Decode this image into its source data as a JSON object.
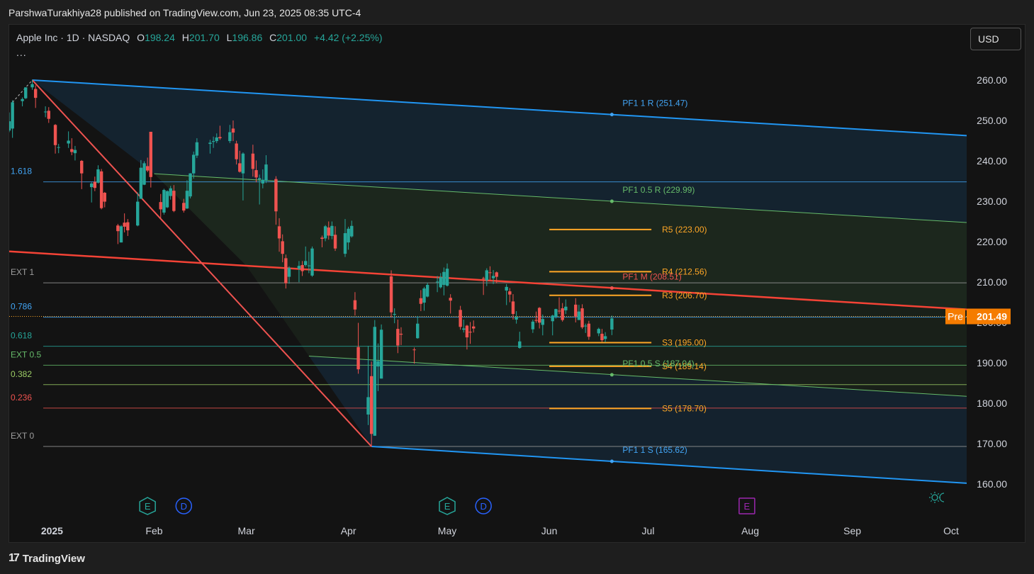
{
  "publisher": "ParshwaTurakhiya28 published on TradingView.com, Jun 23, 2025 08:35 UTC-4",
  "legend": {
    "symbol": "Apple Inc · 1D · NASDAQ",
    "o_label": "O",
    "o": "198.24",
    "h_label": "H",
    "h": "201.70",
    "l_label": "L",
    "l": "196.86",
    "c_label": "C",
    "c": "201.00",
    "change": "+4.42 (+2.25%)",
    "more": "..."
  },
  "currency": "USD",
  "brand": "TradingView",
  "colors": {
    "up": "#26a69a",
    "down": "#ef5350",
    "channel": "#2196f3",
    "mid": "#f44336",
    "pivot": "#ffa726",
    "inner": "#66bb6a"
  },
  "icons": [
    "theme-toggle-icon"
  ],
  "chart_data": {
    "type": "candlestick",
    "ylim": [
      155,
      265
    ],
    "yticks": [
      "260.00",
      "250.00",
      "240.00",
      "230.00",
      "220.00",
      "210.00",
      "200.00",
      "190.00",
      "180.00",
      "170.00",
      "160.00"
    ],
    "x_start": "2024-12-19",
    "x_end": "2025-10-06",
    "xticks": [
      {
        "date": "2025-01-01",
        "label": "2025"
      },
      {
        "date": "2025-02-01",
        "label": "Feb"
      },
      {
        "date": "2025-03-01",
        "label": "Mar"
      },
      {
        "date": "2025-04-01",
        "label": "Apr"
      },
      {
        "date": "2025-05-01",
        "label": "May"
      },
      {
        "date": "2025-06-01",
        "label": "Jun"
      },
      {
        "date": "2025-07-01",
        "label": "Jul"
      },
      {
        "date": "2025-08-01",
        "label": "Aug"
      },
      {
        "date": "2025-09-01",
        "label": "Sep"
      },
      {
        "date": "2025-10-01",
        "label": "Oct"
      }
    ],
    "price_label": {
      "tag": "Pre",
      "value": "201.49",
      "y": 201.49
    },
    "fib_levels": [
      {
        "label": "1.618",
        "y": 234.8,
        "color": "#42a5f5"
      },
      {
        "label": "EXT 1",
        "y": 209.8,
        "color": "#9e9e9e"
      },
      {
        "label": "0.786",
        "y": 201.3,
        "color": "#42a5f5"
      },
      {
        "label": "0.618",
        "y": 194.1,
        "color": "#26a69a"
      },
      {
        "label": "EXT 0.5",
        "y": 189.4,
        "color": "#66bb6a"
      },
      {
        "label": "0.382",
        "y": 184.6,
        "color": "#9ccc65"
      },
      {
        "label": "0.236",
        "y": 178.8,
        "color": "#ef5350"
      },
      {
        "label": "EXT 0",
        "y": 169.3,
        "color": "#9e9e9e"
      }
    ],
    "pivots": [
      {
        "label": "R5 (223.00)",
        "y": 223.0
      },
      {
        "label": "R4 (212.56)",
        "y": 212.56
      },
      {
        "label": "R3 (206.70)",
        "y": 206.7
      },
      {
        "label": "S3 (195.00)",
        "y": 195.0
      },
      {
        "label": "S4 (189.14)",
        "y": 189.14
      },
      {
        "label": "S5 (178.70)",
        "y": 178.7
      }
    ],
    "pivot_span": [
      "2025-06-01",
      "2025-07-02"
    ],
    "channel_labels": [
      {
        "label": "PF1 1 R (251.47)",
        "y": 251.47,
        "color": "#42a5f5"
      },
      {
        "label": "PF1 0.5 R (229.99)",
        "y": 229.99,
        "color": "#66bb6a"
      },
      {
        "label": "PF1 M (208.51)",
        "y": 208.51,
        "color": "#ef5350"
      },
      {
        "label": "PF1 0.5 S (187.04)",
        "y": 187.04,
        "color": "#66bb6a"
      },
      {
        "label": "PF1 1 S (165.62)",
        "y": 165.62,
        "color": "#42a5f5"
      }
    ],
    "channel_label_date": "2025-06-20",
    "events": [
      {
        "label": "E",
        "date": "2025-01-30",
        "color": "#26a69a"
      },
      {
        "label": "D",
        "date": "2025-02-10",
        "color": "#2962ff"
      },
      {
        "label": "E",
        "date": "2025-05-01",
        "color": "#26a69a"
      },
      {
        "label": "D",
        "date": "2025-05-12",
        "color": "#2962ff"
      },
      {
        "label": "E",
        "date": "2025-07-31",
        "color": "#9c27b0"
      }
    ],
    "series": [
      {
        "d": "2024-12-19",
        "o": 247.5,
        "h": 252.0,
        "l": 247.1,
        "c": 249.8
      },
      {
        "d": "2024-12-20",
        "o": 248.0,
        "h": 255.0,
        "l": 245.7,
        "c": 254.5
      },
      {
        "d": "2024-12-23",
        "o": 254.8,
        "h": 255.7,
        "l": 253.5,
        "c": 255.3
      },
      {
        "d": "2024-12-24",
        "o": 255.5,
        "h": 258.2,
        "l": 255.3,
        "c": 258.2
      },
      {
        "d": "2024-12-26",
        "o": 258.2,
        "h": 260.1,
        "l": 257.6,
        "c": 259.0
      },
      {
        "d": "2024-12-27",
        "o": 257.8,
        "h": 258.7,
        "l": 253.1,
        "c": 255.6
      },
      {
        "d": "2024-12-30",
        "o": 252.2,
        "h": 253.5,
        "l": 250.8,
        "c": 252.2
      },
      {
        "d": "2024-12-31",
        "o": 252.4,
        "h": 253.3,
        "l": 249.4,
        "c": 250.4
      },
      {
        "d": "2025-01-02",
        "o": 248.9,
        "h": 249.1,
        "l": 241.8,
        "c": 243.9
      },
      {
        "d": "2025-01-03",
        "o": 243.4,
        "h": 244.2,
        "l": 241.9,
        "c": 243.4
      },
      {
        "d": "2025-01-06",
        "o": 244.3,
        "h": 247.3,
        "l": 243.2,
        "c": 245.0
      },
      {
        "d": "2025-01-07",
        "o": 242.9,
        "h": 245.6,
        "l": 241.4,
        "c": 242.2
      },
      {
        "d": "2025-01-08",
        "o": 241.9,
        "h": 243.7,
        "l": 240.1,
        "c": 242.7
      },
      {
        "d": "2025-01-10",
        "o": 240.0,
        "h": 240.2,
        "l": 233.0,
        "c": 236.9
      },
      {
        "d": "2025-01-13",
        "o": 233.5,
        "h": 234.7,
        "l": 229.7,
        "c": 234.4
      },
      {
        "d": "2025-01-14",
        "o": 234.8,
        "h": 236.1,
        "l": 232.5,
        "c": 233.3
      },
      {
        "d": "2025-01-15",
        "o": 234.6,
        "h": 238.9,
        "l": 234.4,
        "c": 237.9
      },
      {
        "d": "2025-01-16",
        "o": 237.4,
        "h": 238.0,
        "l": 228.0,
        "c": 228.3
      },
      {
        "d": "2025-01-17",
        "o": 232.1,
        "h": 232.3,
        "l": 228.5,
        "c": 229.9
      },
      {
        "d": "2025-01-21",
        "o": 224.0,
        "h": 224.4,
        "l": 219.4,
        "c": 222.6
      },
      {
        "d": "2025-01-22",
        "o": 219.8,
        "h": 224.1,
        "l": 219.8,
        "c": 223.8
      },
      {
        "d": "2025-01-23",
        "o": 224.7,
        "h": 227.0,
        "l": 222.3,
        "c": 223.7
      },
      {
        "d": "2025-01-24",
        "o": 224.8,
        "h": 225.6,
        "l": 221.4,
        "c": 222.8
      },
      {
        "d": "2025-01-27",
        "o": 224.0,
        "h": 232.2,
        "l": 223.8,
        "c": 229.9
      },
      {
        "d": "2025-01-28",
        "o": 230.6,
        "h": 240.2,
        "l": 230.8,
        "c": 238.3
      },
      {
        "d": "2025-01-29",
        "o": 234.1,
        "h": 239.9,
        "l": 234.0,
        "c": 239.4
      },
      {
        "d": "2025-01-30",
        "o": 238.7,
        "h": 240.8,
        "l": 237.2,
        "c": 237.6
      },
      {
        "d": "2025-01-31",
        "o": 247.2,
        "h": 247.2,
        "l": 233.4,
        "c": 236.0
      },
      {
        "d": "2025-02-03",
        "o": 229.8,
        "h": 231.8,
        "l": 225.7,
        "c": 228.0
      },
      {
        "d": "2025-02-04",
        "o": 227.2,
        "h": 233.1,
        "l": 226.7,
        "c": 232.8
      },
      {
        "d": "2025-02-05",
        "o": 228.5,
        "h": 232.7,
        "l": 228.3,
        "c": 232.5
      },
      {
        "d": "2025-02-06",
        "o": 231.3,
        "h": 233.8,
        "l": 230.4,
        "c": 233.2
      },
      {
        "d": "2025-02-07",
        "o": 232.6,
        "h": 234.0,
        "l": 227.3,
        "c": 227.6
      },
      {
        "d": "2025-02-10",
        "o": 229.6,
        "h": 230.6,
        "l": 227.2,
        "c": 227.7
      },
      {
        "d": "2025-02-11",
        "o": 228.2,
        "h": 235.2,
        "l": 228.1,
        "c": 232.6
      },
      {
        "d": "2025-02-12",
        "o": 231.2,
        "h": 236.96,
        "l": 230.7,
        "c": 236.9
      },
      {
        "d": "2025-02-13",
        "o": 236.9,
        "h": 242.3,
        "l": 235.6,
        "c": 241.5
      },
      {
        "d": "2025-02-14",
        "o": 241.3,
        "h": 245.6,
        "l": 240.7,
        "c": 244.6
      },
      {
        "d": "2025-02-18",
        "o": 244.2,
        "h": 245.2,
        "l": 241.8,
        "c": 244.5
      },
      {
        "d": "2025-02-19",
        "o": 244.7,
        "h": 246.0,
        "l": 243.2,
        "c": 244.9
      },
      {
        "d": "2025-02-20",
        "o": 244.9,
        "h": 246.8,
        "l": 244.4,
        "c": 245.8
      },
      {
        "d": "2025-02-21",
        "o": 245.9,
        "h": 248.7,
        "l": 245.2,
        "c": 245.6
      },
      {
        "d": "2025-02-24",
        "o": 244.9,
        "h": 248.9,
        "l": 244.4,
        "c": 247.1
      },
      {
        "d": "2025-02-25",
        "o": 248.0,
        "h": 250.0,
        "l": 244.9,
        "c": 247.0
      },
      {
        "d": "2025-02-26",
        "o": 244.3,
        "h": 244.98,
        "l": 239.1,
        "c": 240.4
      },
      {
        "d": "2025-02-27",
        "o": 239.4,
        "h": 242.5,
        "l": 237.1,
        "c": 237.3
      },
      {
        "d": "2025-02-28",
        "o": 236.9,
        "h": 242.1,
        "l": 230.2,
        "c": 241.8
      },
      {
        "d": "2025-03-03",
        "o": 241.8,
        "h": 244.0,
        "l": 236.1,
        "c": 238.0
      },
      {
        "d": "2025-03-04",
        "o": 237.7,
        "h": 240.1,
        "l": 234.7,
        "c": 235.9
      },
      {
        "d": "2025-03-05",
        "o": 235.4,
        "h": 236.6,
        "l": 229.2,
        "c": 235.7
      },
      {
        "d": "2025-03-06",
        "o": 234.4,
        "h": 237.9,
        "l": 233.2,
        "c": 235.3
      },
      {
        "d": "2025-03-07",
        "o": 235.1,
        "h": 241.4,
        "l": 234.5,
        "c": 239.1
      },
      {
        "d": "2025-03-10",
        "o": 235.5,
        "h": 236.2,
        "l": 224.2,
        "c": 227.5
      },
      {
        "d": "2025-03-11",
        "o": 223.8,
        "h": 225.8,
        "l": 217.5,
        "c": 220.8
      },
      {
        "d": "2025-03-12",
        "o": 220.1,
        "h": 221.8,
        "l": 214.9,
        "c": 216.98
      },
      {
        "d": "2025-03-13",
        "o": 215.9,
        "h": 216.8,
        "l": 208.4,
        "c": 209.7
      },
      {
        "d": "2025-03-14",
        "o": 211.3,
        "h": 213.9,
        "l": 209.6,
        "c": 213.5
      },
      {
        "d": "2025-03-17",
        "o": 213.3,
        "h": 215.2,
        "l": 209.97,
        "c": 214.0
      },
      {
        "d": "2025-03-18",
        "o": 214.2,
        "h": 215.2,
        "l": 211.5,
        "c": 212.7
      },
      {
        "d": "2025-03-19",
        "o": 214.2,
        "h": 218.8,
        "l": 213.8,
        "c": 215.2
      },
      {
        "d": "2025-03-20",
        "o": 213.99,
        "h": 217.5,
        "l": 212.2,
        "c": 214.1
      },
      {
        "d": "2025-03-21",
        "o": 211.6,
        "h": 218.8,
        "l": 211.3,
        "c": 218.3
      },
      {
        "d": "2025-03-24",
        "o": 221.0,
        "h": 221.5,
        "l": 218.6,
        "c": 220.7
      },
      {
        "d": "2025-03-25",
        "o": 220.8,
        "h": 224.1,
        "l": 220.1,
        "c": 223.8
      },
      {
        "d": "2025-03-26",
        "o": 223.5,
        "h": 225.0,
        "l": 220.5,
        "c": 221.5
      },
      {
        "d": "2025-03-27",
        "o": 221.4,
        "h": 224.99,
        "l": 220.6,
        "c": 223.9
      },
      {
        "d": "2025-03-28",
        "o": 221.7,
        "h": 223.8,
        "l": 217.7,
        "c": 218.3
      },
      {
        "d": "2025-03-31",
        "o": 217.0,
        "h": 225.6,
        "l": 216.2,
        "c": 222.1
      },
      {
        "d": "2025-04-01",
        "o": 219.8,
        "h": 223.7,
        "l": 218.0,
        "c": 223.2
      },
      {
        "d": "2025-04-02",
        "o": 221.3,
        "h": 225.2,
        "l": 221.0,
        "c": 223.9
      },
      {
        "d": "2025-04-03",
        "o": 205.5,
        "h": 207.5,
        "l": 201.7,
        "c": 203.2
      },
      {
        "d": "2025-04-04",
        "o": 193.9,
        "h": 199.9,
        "l": 187.3,
        "c": 188.4
      },
      {
        "d": "2025-04-07",
        "o": 177.2,
        "h": 194.2,
        "l": 174.6,
        "c": 181.5
      },
      {
        "d": "2025-04-08",
        "o": 186.7,
        "h": 190.3,
        "l": 169.2,
        "c": 172.4
      },
      {
        "d": "2025-04-09",
        "o": 171.95,
        "h": 200.6,
        "l": 171.9,
        "c": 198.9
      },
      {
        "d": "2025-04-10",
        "o": 189.1,
        "h": 194.8,
        "l": 183.0,
        "c": 190.4
      },
      {
        "d": "2025-04-11",
        "o": 186.1,
        "h": 199.5,
        "l": 186.1,
        "c": 198.2
      },
      {
        "d": "2025-04-14",
        "o": 211.4,
        "h": 212.9,
        "l": 201.2,
        "c": 202.5
      },
      {
        "d": "2025-04-15",
        "o": 201.9,
        "h": 203.5,
        "l": 199.8,
        "c": 202.1
      },
      {
        "d": "2025-04-16",
        "o": 198.4,
        "h": 200.7,
        "l": 192.4,
        "c": 194.3
      },
      {
        "d": "2025-04-17",
        "o": 197.2,
        "h": 198.8,
        "l": 194.4,
        "c": 196.98
      },
      {
        "d": "2025-04-21",
        "o": 193.3,
        "h": 193.8,
        "l": 189.8,
        "c": 193.2
      },
      {
        "d": "2025-04-22",
        "o": 196.1,
        "h": 201.6,
        "l": 195.97,
        "c": 199.7
      },
      {
        "d": "2025-04-23",
        "o": 206.0,
        "h": 208.0,
        "l": 202.8,
        "c": 204.6
      },
      {
        "d": "2025-04-24",
        "o": 204.9,
        "h": 208.8,
        "l": 202.9,
        "c": 208.4
      },
      {
        "d": "2025-04-25",
        "o": 206.4,
        "h": 209.8,
        "l": 206.2,
        "c": 209.3
      },
      {
        "d": "2025-04-28",
        "o": 210.0,
        "h": 211.5,
        "l": 207.5,
        "c": 210.1
      },
      {
        "d": "2025-04-29",
        "o": 208.7,
        "h": 212.2,
        "l": 208.4,
        "c": 211.2
      },
      {
        "d": "2025-04-30",
        "o": 209.3,
        "h": 213.6,
        "l": 206.7,
        "c": 212.5
      },
      {
        "d": "2025-05-01",
        "o": 209.1,
        "h": 214.6,
        "l": 208.9,
        "c": 213.3
      },
      {
        "d": "2025-05-02",
        "o": 206.1,
        "h": 206.99,
        "l": 202.2,
        "c": 205.4
      },
      {
        "d": "2025-05-05",
        "o": 203.1,
        "h": 204.1,
        "l": 198.2,
        "c": 198.9
      },
      {
        "d": "2025-05-06",
        "o": 198.2,
        "h": 200.7,
        "l": 197.5,
        "c": 198.5
      },
      {
        "d": "2025-05-07",
        "o": 199.2,
        "h": 199.4,
        "l": 193.3,
        "c": 196.3
      },
      {
        "d": "2025-05-08",
        "o": 197.7,
        "h": 200.1,
        "l": 194.7,
        "c": 197.5
      },
      {
        "d": "2025-05-09",
        "o": 199.0,
        "h": 200.5,
        "l": 197.5,
        "c": 198.5
      },
      {
        "d": "2025-05-12",
        "o": 210.97,
        "h": 211.3,
        "l": 206.8,
        "c": 210.8
      },
      {
        "d": "2025-05-13",
        "o": 210.4,
        "h": 213.4,
        "l": 209.0,
        "c": 212.9
      },
      {
        "d": "2025-05-14",
        "o": 212.4,
        "h": 213.9,
        "l": 210.6,
        "c": 212.3
      },
      {
        "d": "2025-05-15",
        "o": 210.95,
        "h": 212.96,
        "l": 209.5,
        "c": 211.5
      },
      {
        "d": "2025-05-16",
        "o": 212.4,
        "h": 212.6,
        "l": 209.7,
        "c": 211.3
      },
      {
        "d": "2025-05-19",
        "o": 207.9,
        "h": 209.5,
        "l": 204.3,
        "c": 208.8
      },
      {
        "d": "2025-05-20",
        "o": 207.7,
        "h": 208.5,
        "l": 205.0,
        "c": 206.9
      },
      {
        "d": "2025-05-21",
        "o": 205.2,
        "h": 207.0,
        "l": 200.7,
        "c": 202.1
      },
      {
        "d": "2025-05-22",
        "o": 200.7,
        "h": 202.8,
        "l": 199.7,
        "c": 201.4
      },
      {
        "d": "2025-05-23",
        "o": 193.7,
        "h": 197.7,
        "l": 193.5,
        "c": 195.3
      },
      {
        "d": "2025-05-27",
        "o": 198.3,
        "h": 200.7,
        "l": 197.4,
        "c": 200.2
      },
      {
        "d": "2025-05-28",
        "o": 200.6,
        "h": 202.7,
        "l": 199.9,
        "c": 200.4
      },
      {
        "d": "2025-05-29",
        "o": 203.6,
        "h": 203.8,
        "l": 198.5,
        "c": 199.95
      },
      {
        "d": "2025-05-30",
        "o": 199.4,
        "h": 201.96,
        "l": 196.8,
        "c": 200.85
      },
      {
        "d": "2025-06-02",
        "o": 200.3,
        "h": 201.9,
        "l": 196.8,
        "c": 201.7
      },
      {
        "d": "2025-06-03",
        "o": 201.4,
        "h": 203.4,
        "l": 200.96,
        "c": 203.3
      },
      {
        "d": "2025-06-04",
        "o": 202.9,
        "h": 206.2,
        "l": 202.1,
        "c": 202.8
      },
      {
        "d": "2025-06-05",
        "o": 203.5,
        "h": 204.8,
        "l": 200.2,
        "c": 200.6
      },
      {
        "d": "2025-06-06",
        "o": 203.0,
        "h": 205.7,
        "l": 202.1,
        "c": 203.9
      },
      {
        "d": "2025-06-09",
        "o": 204.4,
        "h": 206.0,
        "l": 200.0,
        "c": 201.45
      },
      {
        "d": "2025-06-10",
        "o": 200.6,
        "h": 204.35,
        "l": 200.6,
        "c": 202.7
      },
      {
        "d": "2025-06-11",
        "o": 203.5,
        "h": 204.5,
        "l": 198.4,
        "c": 198.8
      },
      {
        "d": "2025-06-12",
        "o": 199.1,
        "h": 199.7,
        "l": 197.4,
        "c": 199.2
      },
      {
        "d": "2025-06-13",
        "o": 199.7,
        "h": 200.4,
        "l": 195.7,
        "c": 196.45
      },
      {
        "d": "2025-06-16",
        "o": 197.3,
        "h": 198.7,
        "l": 196.6,
        "c": 198.4
      },
      {
        "d": "2025-06-17",
        "o": 197.2,
        "h": 198.4,
        "l": 195.2,
        "c": 195.6
      },
      {
        "d": "2025-06-18",
        "o": 195.9,
        "h": 197.6,
        "l": 195.1,
        "c": 196.6
      },
      {
        "d": "2025-06-20",
        "o": 198.24,
        "h": 201.7,
        "l": 196.86,
        "c": 201.0
      }
    ]
  }
}
